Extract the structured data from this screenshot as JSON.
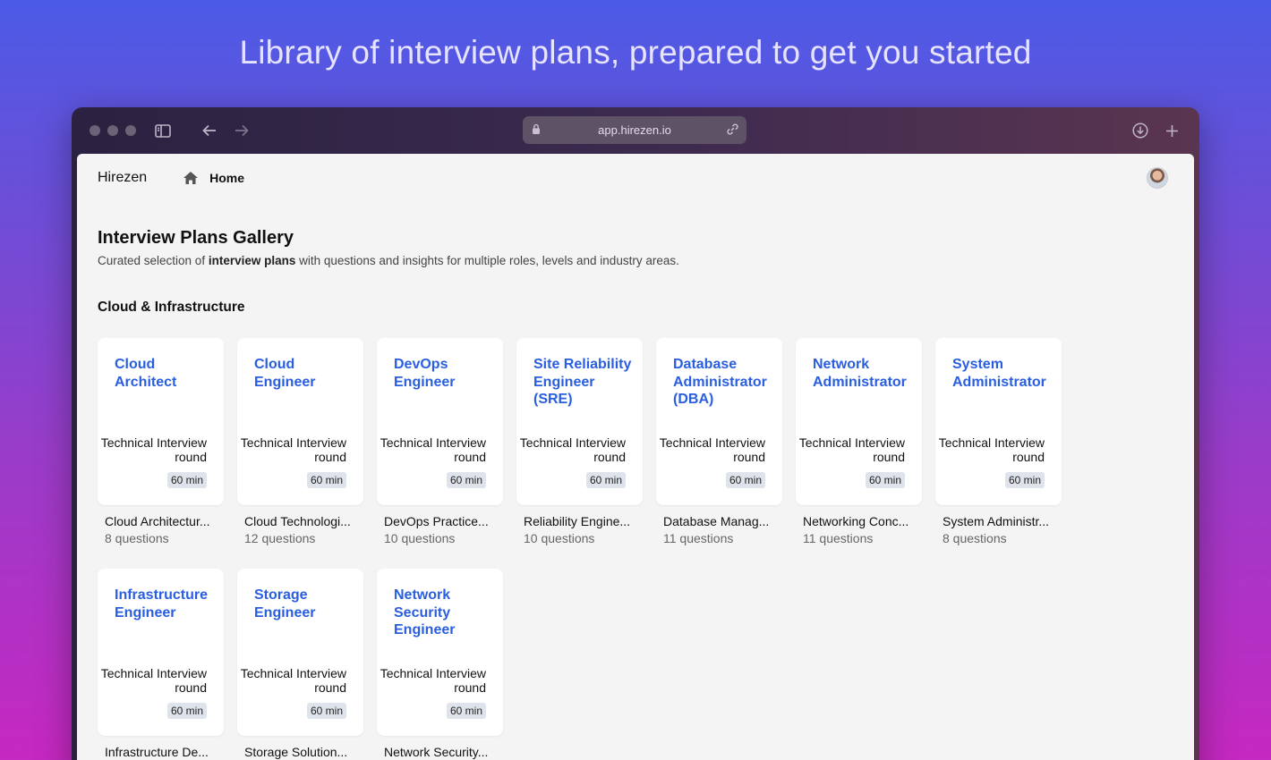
{
  "hero": {
    "title": "Library of interview plans, prepared to get you started"
  },
  "browser": {
    "url": "app.hirezen.io"
  },
  "nav": {
    "brand": "Hirezen",
    "home_label": "Home"
  },
  "page": {
    "title": "Interview Plans Gallery",
    "subtitle_prefix": "Curated selection of ",
    "subtitle_bold": "interview plans",
    "subtitle_suffix": " with questions and insights for multiple roles, levels and industry areas."
  },
  "section": {
    "title": "Cloud & Infrastructure"
  },
  "cards": [
    {
      "title": "Cloud Architect",
      "round": "Technical Interview round",
      "duration": "60 min",
      "topic": "Cloud Architectur...",
      "count": "8 questions"
    },
    {
      "title": "Cloud Engineer",
      "round": "Technical Interview round",
      "duration": "60 min",
      "topic": "Cloud Technologi...",
      "count": "12 questions"
    },
    {
      "title": "DevOps Engineer",
      "round": "Technical Interview round",
      "duration": "60 min",
      "topic": "DevOps Practice...",
      "count": "10 questions"
    },
    {
      "title": "Site Reliability Engineer (SRE)",
      "round": "Technical Interview round",
      "duration": "60 min",
      "topic": "Reliability Engine...",
      "count": "10 questions"
    },
    {
      "title": "Database Administrator (DBA)",
      "round": "Technical Interview round",
      "duration": "60 min",
      "topic": "Database Manag...",
      "count": "11 questions"
    },
    {
      "title": "Network Administrator",
      "round": "Technical Interview round",
      "duration": "60 min",
      "topic": "Networking Conc...",
      "count": "11 questions"
    },
    {
      "title": "System Administrator",
      "round": "Technical Interview round",
      "duration": "60 min",
      "topic": "System Administr...",
      "count": "8 questions"
    },
    {
      "title": "Infrastructure Engineer",
      "round": "Technical Interview round",
      "duration": "60 min",
      "topic": "Infrastructure De...",
      "count": ""
    },
    {
      "title": "Storage Engineer",
      "round": "Technical Interview round",
      "duration": "60 min",
      "topic": "Storage Solution...",
      "count": ""
    },
    {
      "title": "Network Security Engineer",
      "round": "Technical Interview round",
      "duration": "60 min",
      "topic": "Network Security...",
      "count": ""
    }
  ]
}
